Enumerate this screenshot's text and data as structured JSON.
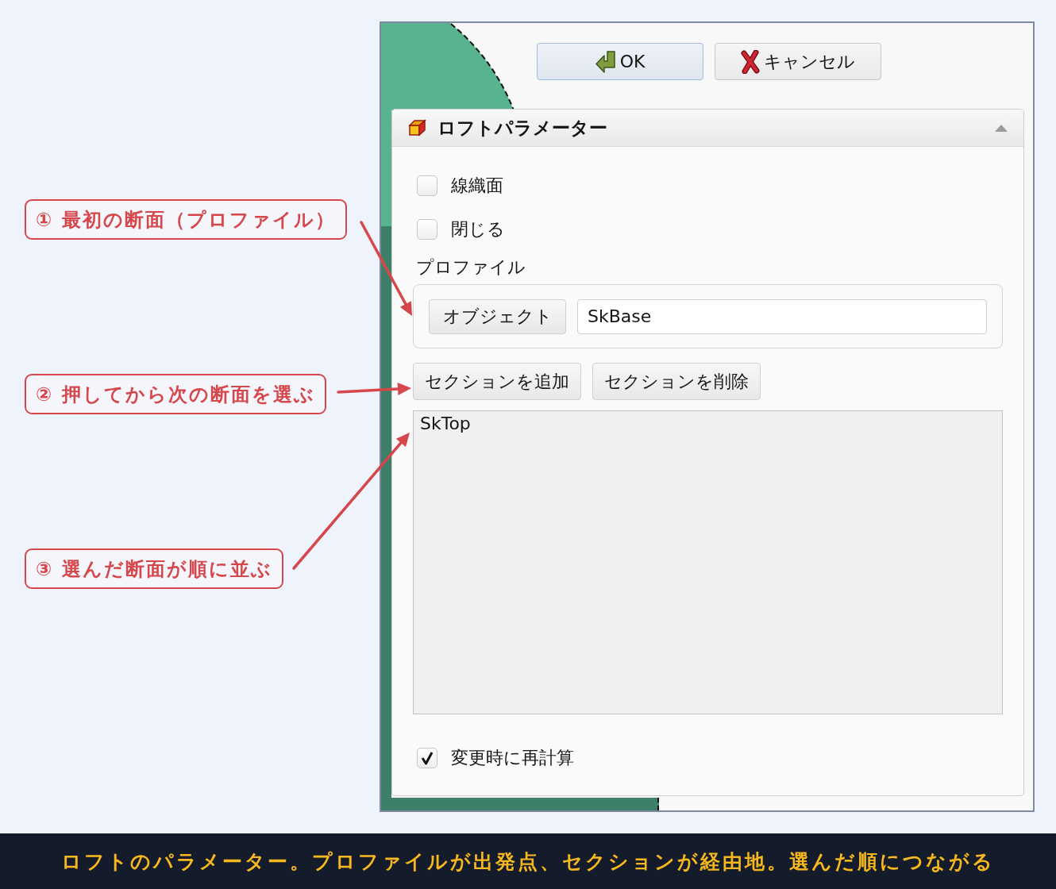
{
  "callouts": [
    "① 最初の断面（プロファイル）",
    "② 押してから次の断面を選ぶ",
    "③ 選んだ断面が順に並ぶ"
  ],
  "dialog_buttons": [
    {
      "kind": "ok",
      "label": "OK",
      "default": true
    },
    {
      "kind": "cancel",
      "label": "キャンセル",
      "default": false
    }
  ],
  "task_panel": {
    "title": "ロフトパラメーター",
    "expanded": true,
    "options": [
      {
        "label": "線織面",
        "checked": false
      },
      {
        "label": "閉じる",
        "checked": false
      }
    ],
    "profile": {
      "label": "プロファイル",
      "button": "オブジェクト",
      "value": "SkBase"
    },
    "section_buttons": [
      "セクションを追加",
      "セクションを削除"
    ],
    "sections": [
      {
        "name": "SkTop",
        "selected": false
      }
    ],
    "recompute": {
      "label": "変更時に再計算",
      "checked": true
    }
  },
  "caption": "ロフトのパラメーター。プロファイルが出発点、セクションが経由地。選んだ順につながる"
}
